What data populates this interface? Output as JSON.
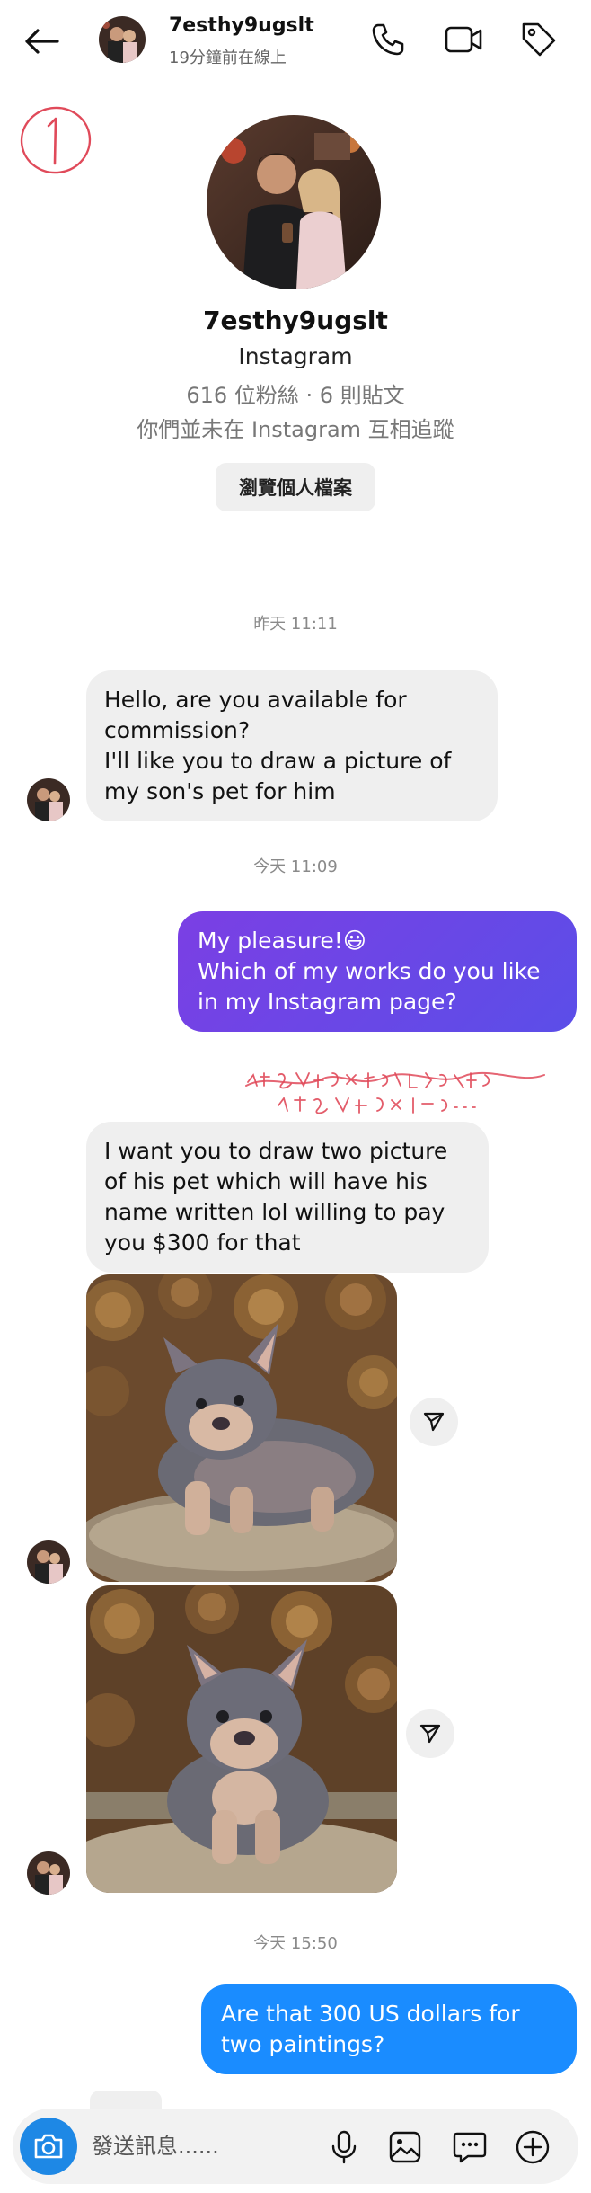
{
  "header": {
    "username": "7esthy9ugslt",
    "status": "19分鐘前在線上",
    "icons": [
      "back-arrow-icon",
      "phone-icon",
      "video-icon",
      "tag-icon"
    ]
  },
  "profile": {
    "name": "7esthy9ugslt",
    "platform": "Instagram",
    "stats": "616 位粉絲 · 6 則貼文",
    "follow_status": "你們並未在 Instagram 互相追蹤",
    "view_profile_label": "瀏覽個人檔案"
  },
  "messages": {
    "ts1": "昨天 11:11",
    "msg1": "Hello, are you available for commission?\nI'll like you to draw a picture of my son's pet for him",
    "ts2": "今天 11:09",
    "msg2_line1": "My pleasure!😃",
    "msg2_line2": "Which of my works do you like in my Instagram page?",
    "msg3": "I want you to draw two picture of his pet which will have his name written lol willing to pay you $300 for that",
    "ts3": "今天 15:50",
    "msg4": "Are that 300 US dollars for two paintings?"
  },
  "composer": {
    "placeholder": "發送訊息......",
    "icons": [
      "camera-icon",
      "microphone-icon",
      "gallery-icon",
      "sticker-icon",
      "plus-icon"
    ]
  },
  "colors": {
    "incoming_bubble": "#efefef",
    "outgoing_gradient_start": "#7b3fe4",
    "outgoing_gradient_end": "#5b4ee8",
    "outgoing_blue": "#1a8cff",
    "annotation_red": "#e04a5a"
  }
}
